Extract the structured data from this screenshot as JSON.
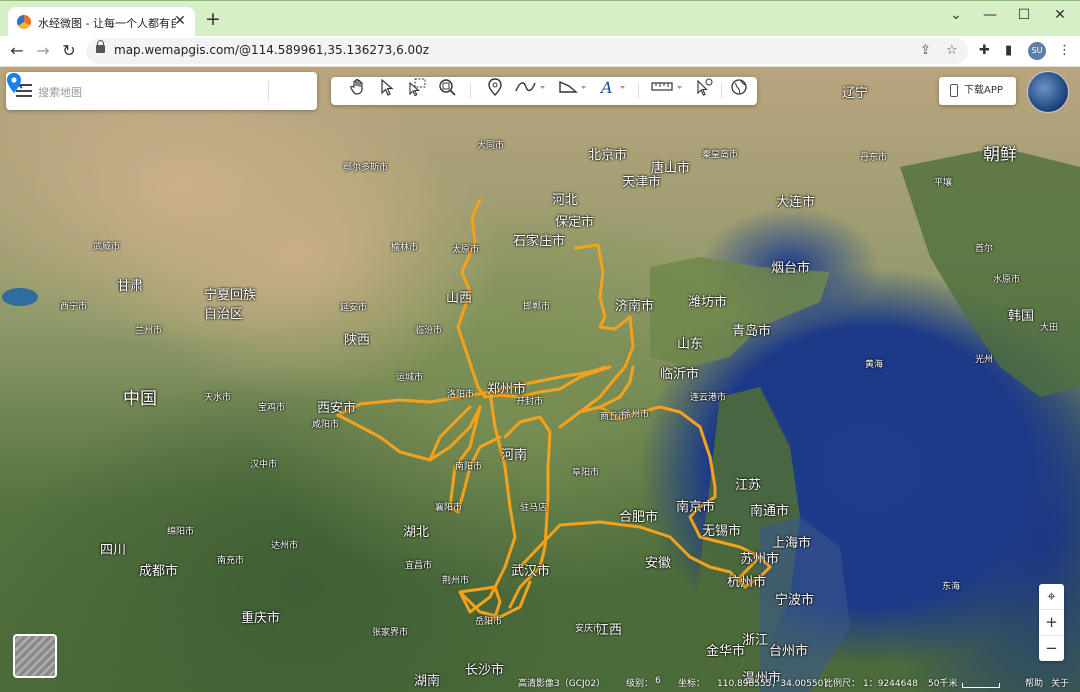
{
  "browser": {
    "tab_title": "水经微图 - 让每一个人都有自己",
    "url": "map.wemapgis.com/@114.589961,35.136273,6.00z",
    "profile": "SU"
  },
  "search": {
    "placeholder": "搜索地图"
  },
  "download_app": "下载APP",
  "icons": [
    "hand-pan-icon",
    "pointer-icon",
    "select-icon",
    "zoom-box-icon",
    "location-pin-icon",
    "polyline-icon",
    "polygon-icon",
    "text-icon",
    "ruler-icon",
    "pick-icon",
    "globe-icon"
  ],
  "colors": {
    "route": "#f4a21b",
    "sea": "#1e3c8c",
    "land": "#55733f"
  },
  "map_labels": {
    "china": "中国",
    "korea": "朝鲜",
    "south_korea": "韩国",
    "yellow_sea": "黄海",
    "east_sea": "东海",
    "hebei": "河北",
    "shanxi": "山西",
    "shaanxi": "陕西",
    "henan": "河南",
    "hubei": "湖北",
    "hunan": "湖南",
    "anhui": "安徽",
    "jiangsu": "江苏",
    "shandong": "山东",
    "sichuan": "四川",
    "gansu": "甘肃",
    "ningxia": "宁夏回族自治区",
    "zhejiang": "浙江",
    "jiangxi": "江西",
    "liaoning": "辽宁",
    "beijing": "北京市",
    "tianjin": "天津市",
    "tangshan": "唐山市",
    "qinhuangdao": "秦皇岛市",
    "shijiazhuang": "石家庄市",
    "baoding": "保定市",
    "taiyuan": "太原市",
    "datong": "大同市",
    "xian": "西安市",
    "xianyang": "咸阳市",
    "zhengzhou": "郑州市",
    "kaifeng": "开封市",
    "luoyang": "洛阳市",
    "jinan": "济南市",
    "qingdao": "青岛市",
    "weifang": "潍坊市",
    "yantai": "烟台市",
    "linyi": "临沂市",
    "xuzhou": "徐州市",
    "lianyungang": "连云港市",
    "nanjing": "南京市",
    "nantong": "南通市",
    "wuxi": "无锡市",
    "suzhou": "苏州市",
    "shanghai": "上海市",
    "hangzhou": "杭州市",
    "ningbo": "宁波市",
    "hefei": "合肥市",
    "wuhan": "武汉市",
    "yichang": "宜昌市",
    "jingzhou": "荆州市",
    "xiangyang": "襄阳市",
    "nanyang": "南阳市",
    "zhumadian": "驻马店",
    "chengdu": "成都市",
    "chongqing": "重庆市",
    "nanchong": "南充市",
    "dazhou": "达州市",
    "mianyang": "绵阳市",
    "hanzhong": "汉中市",
    "tianshui": "天水市",
    "baoji": "宝鸡市",
    "lanzhou": "兰州市",
    "xining": "西宁市",
    "wuwei": "武威市",
    "dalian": "大连市",
    "shenyang": "沈阳市",
    "dandong": "丹东市",
    "pyongyang": "平壤",
    "seoul": "首尔",
    "suwon": "水原市",
    "daejeon": "大田",
    "gwangju": "光州",
    "changsha": "长沙市",
    "yueyang": "岳阳市",
    "zhangjiajie": "张家界市",
    "jinhua": "金华市",
    "taizhou": "台州市",
    "wenzhou": "温州市",
    "ordos": "鄂尔多斯市",
    "yulin": "榆林市",
    "yanan": "延安市",
    "linfen": "临汾市",
    "yuncheng": "运城市",
    "handan": "邯郸市",
    "shangqiu": "商丘市",
    "fuyang": "阜阳市",
    "anqing": "安庆市"
  },
  "status": {
    "imagery": "高清影像3（GCJ02）",
    "level_label": "级别：",
    "level": "6",
    "coord_label": "坐标：",
    "coords": "110.898555，34.005507",
    "scale_label": "比例尺：",
    "scale": "1：9244648",
    "scalebar": "50千米",
    "help": "帮助",
    "close": "关于"
  }
}
